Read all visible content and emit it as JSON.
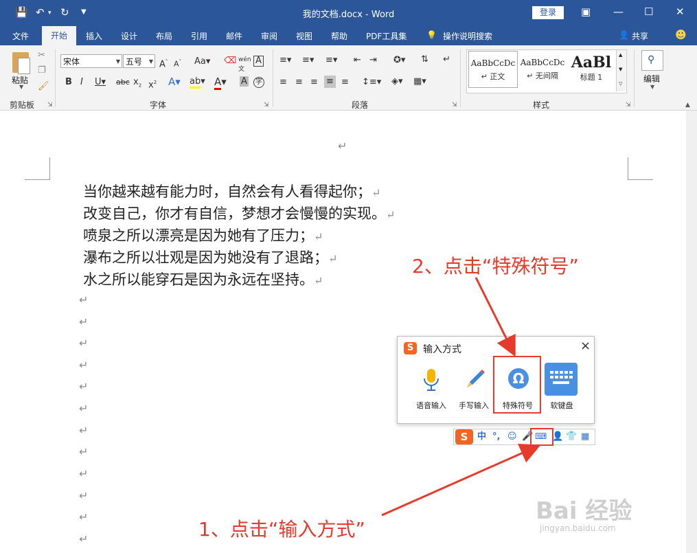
{
  "titlebar": {
    "doc_title": "我的文档.docx  -  Word",
    "login": "登录",
    "icons": [
      "save-icon",
      "undo-icon",
      "redo-icon",
      "customize-qa-icon",
      "ribbon-display-icon",
      "minimize-icon",
      "maximize-icon",
      "close-icon"
    ]
  },
  "tabs": [
    "文件",
    "开始",
    "插入",
    "设计",
    "布局",
    "引用",
    "邮件",
    "审阅",
    "视图",
    "帮助",
    "PDF工具集",
    "操作说明搜索"
  ],
  "share": "共享",
  "ribbon": {
    "clipboard": {
      "paste": "粘贴",
      "label": "剪贴板"
    },
    "font": {
      "name": "宋体",
      "size": "五号",
      "label": "字体"
    },
    "paragraph": {
      "label": "段落"
    },
    "styles": {
      "label": "样式",
      "items": [
        {
          "sample": "AaBbCcDc",
          "name": "↵ 正文"
        },
        {
          "sample": "AaBbCcDc",
          "name": "↵ 无间隔"
        },
        {
          "sample": "AaBl",
          "name": "标题 1"
        }
      ]
    },
    "editing": {
      "label": "编辑"
    }
  },
  "document": {
    "top_mark": "↵",
    "mark": "↵",
    "lines": [
      "当你越来越有能力时，自然会有人看得起你；",
      "改变自己，你才有自信，梦想才会慢慢的实现。",
      "喷泉之所以漂亮是因为她有了压力；",
      "瀑布之所以壮观是因为她没有了退路；",
      "水之所以能穿石是因为永远在坚持。"
    ]
  },
  "ime_popup": {
    "title": "输入方式",
    "close": "×",
    "options": [
      {
        "label": "语音输入",
        "icon": "microphone-icon"
      },
      {
        "label": "手写输入",
        "icon": "pencil-icon"
      },
      {
        "label": "特殊符号",
        "icon": "omega-icon"
      },
      {
        "label": "软键盘",
        "icon": "keyboard-icon"
      }
    ]
  },
  "ime_bar": {
    "mode": "中",
    "punct": "°,"
  },
  "annotations": {
    "step2": "2、点击“特殊符号”",
    "step1": "1、点击“输入方式”"
  },
  "colors": {
    "title_blue": "#2b579a",
    "annotation_red": "#e53a2c",
    "sogou_orange": "#f26522",
    "keyboard_blue": "#4a90e2"
  },
  "watermark": {
    "text": "Bai 经验",
    "url": "jingyan.baidu.com"
  }
}
